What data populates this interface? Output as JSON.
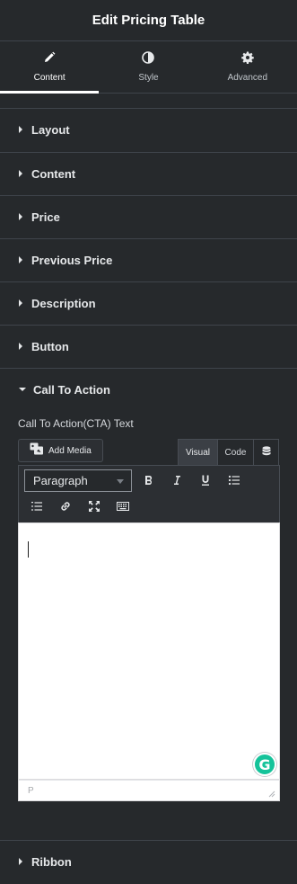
{
  "header": {
    "title": "Edit Pricing Table"
  },
  "tabs": [
    {
      "label": "Content",
      "icon": "pencil-icon",
      "active": true
    },
    {
      "label": "Style",
      "icon": "half-circle-icon",
      "active": false
    },
    {
      "label": "Advanced",
      "icon": "gear-icon",
      "active": false
    }
  ],
  "sections": [
    {
      "label": "Layout"
    },
    {
      "label": "Content"
    },
    {
      "label": "Price"
    },
    {
      "label": "Previous Price"
    },
    {
      "label": "Description"
    },
    {
      "label": "Button"
    },
    {
      "label": "Call To Action"
    },
    {
      "label": "Ribbon"
    }
  ],
  "cta": {
    "field_label": "Call To Action(CTA) Text",
    "add_media_label": "Add Media",
    "mode_visual": "Visual",
    "mode_code": "Code",
    "format_value": "Paragraph",
    "editor_value": "",
    "status_path": "P"
  },
  "colors": {
    "panel_bg": "#26292c",
    "divider": "#3f444b",
    "text": "#e6e8ea",
    "grammarly": "#15c39a"
  }
}
